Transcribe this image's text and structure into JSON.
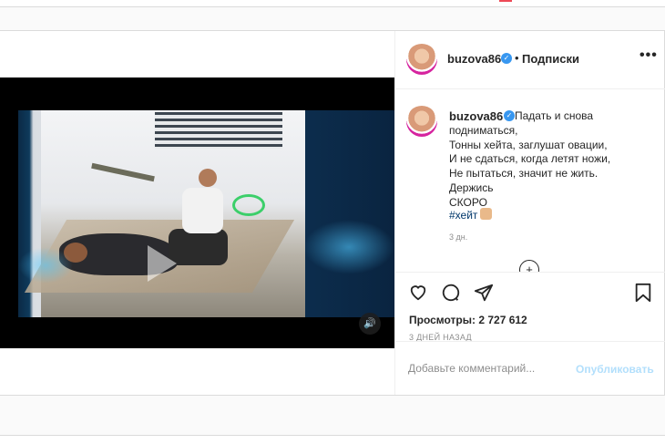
{
  "post": {
    "username": "buzova86",
    "verified": true,
    "separator": "•",
    "follow_label": "Подписки",
    "more_label": "•••",
    "caption": "Падать и снова подниматься,\nТонны хейта, заглушат овации,\nИ не сдаться, когда летят ножи,\nНе пытаться, значит не жить.\nДержись \nСКОРО \n",
    "hashtag": "#хейт",
    "caption_time": "3 дн.",
    "load_more_icon": "plus-circle-icon",
    "views_text": "Просмотры: 2 727 612",
    "posted_ago": "3 ДНЕЙ НАЗАД"
  },
  "actions": {
    "like_icon": "heart-icon",
    "comment_icon": "comment-icon",
    "share_icon": "send-icon",
    "save_icon": "bookmark-icon"
  },
  "comment_box": {
    "placeholder": "Добавьте комментарий...",
    "publish_label": "Опубликовать"
  },
  "video": {
    "play_icon": "play-icon",
    "sound_icon": "speaker-icon"
  },
  "colors": {
    "link_blue": "#00376b",
    "verified_blue": "#3897f0",
    "publish_disabled": "#b2dffc",
    "border": "#dbdbdb"
  }
}
